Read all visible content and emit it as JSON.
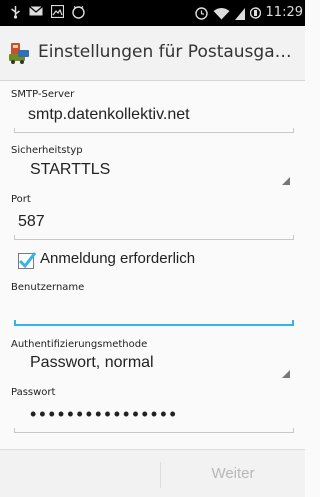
{
  "status_bar": {
    "time": "11:29",
    "icons": [
      "usb-icon",
      "mail-icon",
      "image-icon",
      "clock-icon",
      "alarm-icon",
      "wifi-icon",
      "signal-icon",
      "battery-icon"
    ]
  },
  "action_bar": {
    "title": "Einstellungen für Postausgang..."
  },
  "form": {
    "smtp_label": "SMTP-Server",
    "smtp_value": "smtp.datenkollektiv.net",
    "security_label": "Sicherheitstyp",
    "security_value": "STARTTLS",
    "port_label": "Port",
    "port_value": "587",
    "auth_required_label": "Anmeldung erforderlich",
    "auth_required_checked": true,
    "username_label": "Benutzername",
    "username_value": "",
    "auth_method_label": "Authentifizierungsmethode",
    "auth_method_value": "Passwort, normal",
    "password_label": "Passwort",
    "password_value": "••••••••••••••••"
  },
  "bottom_bar": {
    "next_label": "Weiter"
  },
  "colors": {
    "accent": "#33b5e5",
    "checkbox": "#33b5e5",
    "disabled_text": "#b8b8b8"
  }
}
